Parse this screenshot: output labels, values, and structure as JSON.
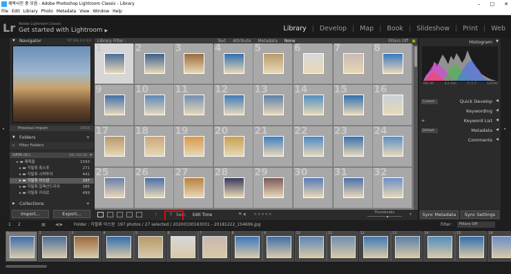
{
  "window": {
    "title": "제목사진 중 모음 - Adobe Photoshop Lightroom Classic - Library",
    "controls": [
      "–",
      "□",
      "✕"
    ]
  },
  "menu": [
    "File",
    "Edit",
    "Library",
    "Photo",
    "Metadata",
    "View",
    "Window",
    "Help"
  ],
  "identity": {
    "logo": "Lr",
    "brand": "Adobe Lightroom Classic",
    "subtitle": "Get started with Lightroom",
    "subtitle_arrow": "▶"
  },
  "modules": [
    "Library",
    "Develop",
    "Map",
    "Book",
    "Slideshow",
    "Print",
    "Web"
  ],
  "left": {
    "navigator": {
      "title": "Navigator",
      "zoom": [
        "FIT",
        "FILL",
        "1:1",
        "3:1"
      ]
    },
    "previous_import": {
      "label": "Previous Import",
      "count": "1593"
    },
    "folders": {
      "title": "Folders",
      "filter": "Filter Folders",
      "volume": "DATA (D:)",
      "volume_info": "400 / 931 GB",
      "items": [
        {
          "name": "제목들",
          "count": "1593"
        },
        {
          "name": "각필휘 폭스포",
          "count": "271"
        },
        {
          "name": "각필휘 시박투아",
          "count": "441"
        },
        {
          "name": "각필휘 아스완",
          "count": "197"
        },
        {
          "name": "각필휘 알렉산드리아",
          "count": "185"
        },
        {
          "name": "각필휘 카이로",
          "count": "499"
        }
      ]
    },
    "collections": {
      "title": "Collections"
    },
    "import_btn": "Import...",
    "export_btn": "Export..."
  },
  "center": {
    "filter_bar": {
      "title": "Library Filter :",
      "tabs": [
        "Text",
        "Attribute",
        "Metadata",
        "None"
      ],
      "preset": "Filters Off"
    },
    "cells": [
      "1",
      "2",
      "3",
      "4",
      "5",
      "6",
      "7",
      "8",
      "9",
      "10",
      "11",
      "12",
      "13",
      "14",
      "15",
      "16",
      "17",
      "18",
      "19",
      "20",
      "21",
      "22",
      "23",
      "24",
      "25",
      "26",
      "27",
      "28",
      "29",
      "30",
      "31",
      "32"
    ],
    "thumb_colors": [
      "#4a6f9a",
      "#3b5f8c",
      "#9a6a3a",
      "#2f6fb0",
      "#b89a6a",
      "#d8d8d8",
      "#c9b8b0",
      "#3a78c0",
      "#3f6fa8",
      "#5a87b8",
      "#6f8fb0",
      "#3f7ab8",
      "#5a7fa8",
      "#4f8fc0",
      "#2f6fb0",
      "#c8d0d8",
      "#b8986a",
      "#c8a87a",
      "#d89a4a",
      "#c8a050",
      "#3f7fc0",
      "#4a88c8",
      "#3a6fb0",
      "#5a8fc8",
      "#6a7fa8",
      "#4a6fa8",
      "#b88040",
      "#3a3a5a",
      "#7a5a5a",
      "#5a7ab8",
      "#4a6fa8",
      "#6a8fc8"
    ],
    "toolbar": {
      "sort_label": "Sort:",
      "sort_value": "Edit Time",
      "stars": "★★★★★",
      "thumbnails": "Thumbnails"
    }
  },
  "right": {
    "histogram": {
      "title": "Histogram",
      "readout": [
        "ISO 50",
        "4.2 mm",
        "f / 1.7",
        "1/1100"
      ]
    },
    "quick_develop": {
      "preset": "Custom",
      "title": "Quick Develop"
    },
    "keywording": "Keywording",
    "keyword_list": "Keyword List",
    "metadata": {
      "preset": "Default",
      "title": "Metadata"
    },
    "comments": "Comments",
    "sync_metadata": "Sync Metadata",
    "sync_settings": "Sync Settings"
  },
  "filmstrip": {
    "monitors": [
      "1",
      "2"
    ],
    "folder_label": "Folder : 각필휘 아스완",
    "count_text": "197 photos / 27 selected / 20200330163031 - 20181222_154606.jpg",
    "filter_label": "Filter :",
    "filter_value": "Filters Off",
    "numbers": [
      "1",
      "2",
      "3",
      "4",
      "5",
      "6",
      "7",
      "8",
      "9",
      "10",
      "11",
      "12",
      "13",
      "14",
      "15",
      "16"
    ],
    "colors": [
      "#3a6fb0",
      "#4a6f9a",
      "#9a6a3a",
      "#2f6fb0",
      "#b89a6a",
      "#d8d8d8",
      "#c9b8b0",
      "#3a78c0",
      "#3f6fa8",
      "#5a87b8",
      "#6f8fb0",
      "#3f7ab8",
      "#5a7fa8",
      "#4f8fc0",
      "#2f6fb0",
      "#6a8fc8"
    ]
  }
}
